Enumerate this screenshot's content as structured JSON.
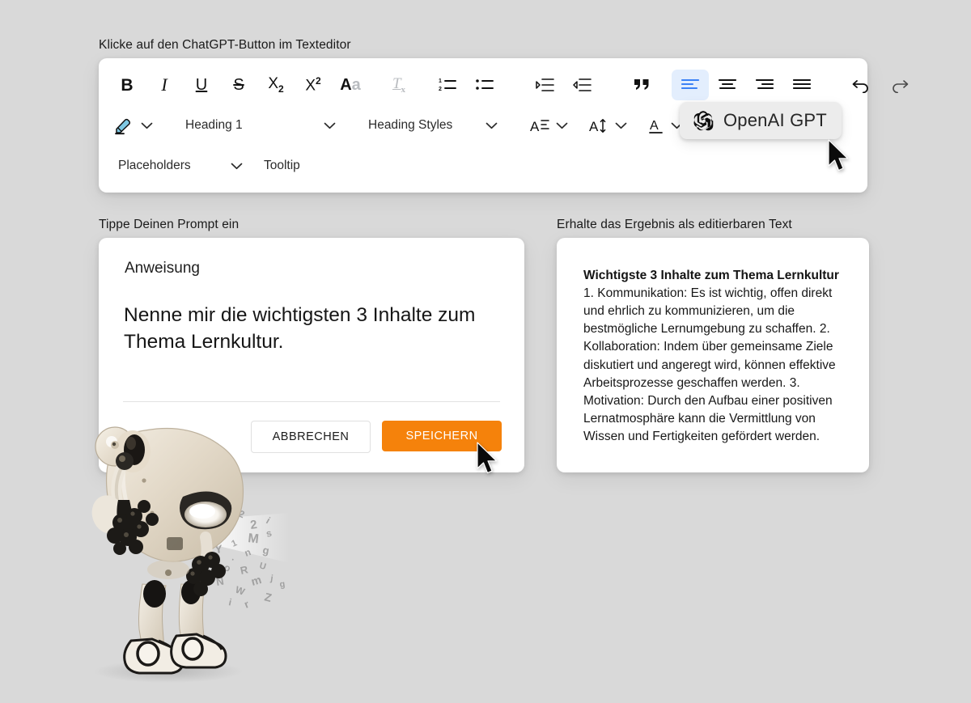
{
  "page": {
    "background_color": "#d9d9d9",
    "accent_orange": "#f5820b",
    "accent_blue": "#3b82f6"
  },
  "sections": {
    "toolbar_label": "Klicke auf den ChatGPT-Button im Texteditor",
    "prompt_label": "Tippe Deinen Prompt ein",
    "result_label": "Erhalte das Ergebnis als editierbaren Text"
  },
  "toolbar": {
    "row1": [
      {
        "name": "bold-icon",
        "glyph": "B"
      },
      {
        "name": "italic-icon",
        "glyph": "I"
      },
      {
        "name": "underline-icon",
        "glyph": "U"
      },
      {
        "name": "strikethrough-icon",
        "glyph": "S"
      },
      {
        "name": "subscript-icon",
        "glyph": "X₂"
      },
      {
        "name": "superscript-icon",
        "glyph": "X²"
      },
      {
        "name": "text-case-icon",
        "glyph": "Aa"
      },
      {
        "name": "clear-formatting-icon",
        "glyph": "Tx"
      },
      {
        "name": "numbered-list-icon",
        "glyph": "1.2."
      },
      {
        "name": "bullet-list-icon",
        "glyph": "••"
      },
      {
        "name": "indent-increase-icon",
        "glyph": "→≡"
      },
      {
        "name": "indent-decrease-icon",
        "glyph": "←≡"
      },
      {
        "name": "blockquote-icon",
        "glyph": "“"
      },
      {
        "name": "align-left-icon",
        "glyph": "≡",
        "active": true
      },
      {
        "name": "align-center-icon",
        "glyph": "≡"
      },
      {
        "name": "align-right-icon",
        "glyph": "≡"
      },
      {
        "name": "align-justify-icon",
        "glyph": "≡"
      },
      {
        "name": "undo-icon",
        "glyph": "↶"
      },
      {
        "name": "redo-icon",
        "glyph": "↷"
      }
    ],
    "highlighter_label": "",
    "heading_select": "Heading 1",
    "heading_styles_select": "Heading Styles",
    "placeholders_select": "Placeholders",
    "tooltip_label": "Tooltip",
    "gpt_button_label": "OpenAI GPT"
  },
  "prompt_card": {
    "title": "Anweisung",
    "text": "Nenne mir die wichtigsten 3 Inhalte zum Thema Lernkultur.",
    "cancel_label": "ABBRECHEN",
    "save_label": "SPEICHERN"
  },
  "result_card": {
    "title": "Wichtigste 3 Inhalte zum Thema Lernkultur",
    "body": "1. Kommunikation: Es ist wichtig, offen direkt und ehrlich zu kommunizieren, um die bestmögliche Lernumgebung zu schaffen. 2. Kollaboration: Indem über gemeinsame Ziele diskutiert und angeregt wird, können effektive Arbeitsprozesse geschaffen werden. 3. Motivation: Durch den Aufbau einer positiven Lernatmosphäre kann die Vermittlung von Wissen und Fertigkeiten gefördert werden."
  }
}
